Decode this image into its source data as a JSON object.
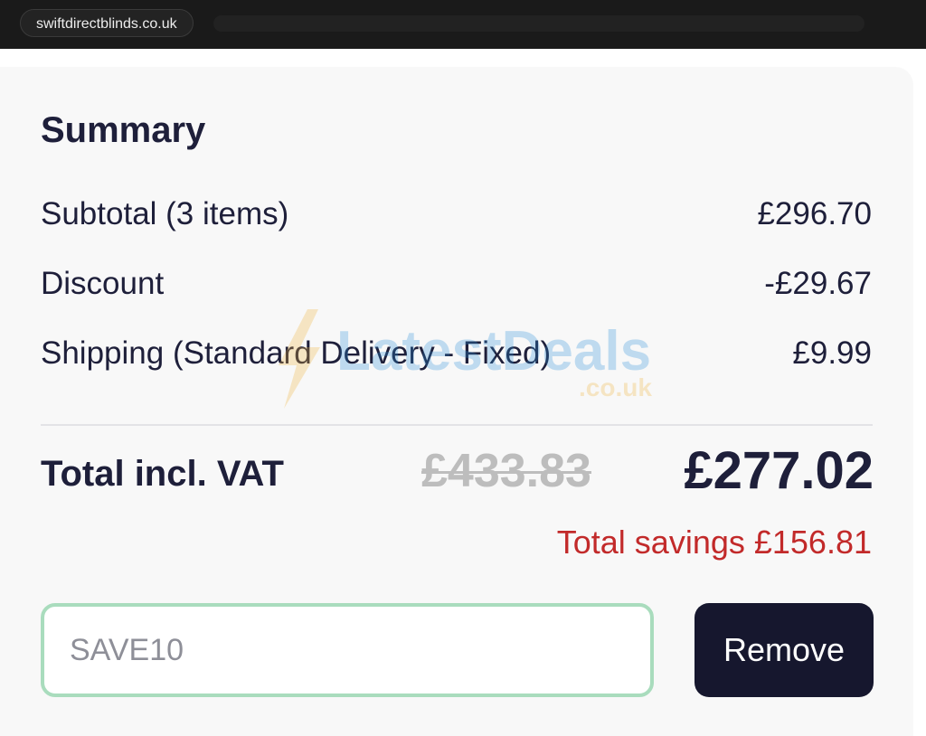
{
  "browser": {
    "url": "swiftdirectblinds.co.uk"
  },
  "summary": {
    "title": "Summary",
    "rows": [
      {
        "label": "Subtotal (3 items)",
        "value": "£296.70"
      },
      {
        "label": "Discount",
        "value": "-£29.67"
      },
      {
        "label": "Shipping (Standard Delivery - Fixed)",
        "value": "£9.99"
      }
    ],
    "total_label": "Total incl. VAT",
    "old_total": "£433.83",
    "new_total": "£277.02",
    "savings": "Total savings £156.81"
  },
  "promo": {
    "code_value": "SAVE10",
    "remove_label": "Remove"
  },
  "watermark": {
    "text": "LatestDeals",
    "sub": ".co.uk"
  },
  "colors": {
    "accent_dark": "#16172e",
    "savings_red": "#c22a2a",
    "input_border_green": "#a9dcbd"
  }
}
